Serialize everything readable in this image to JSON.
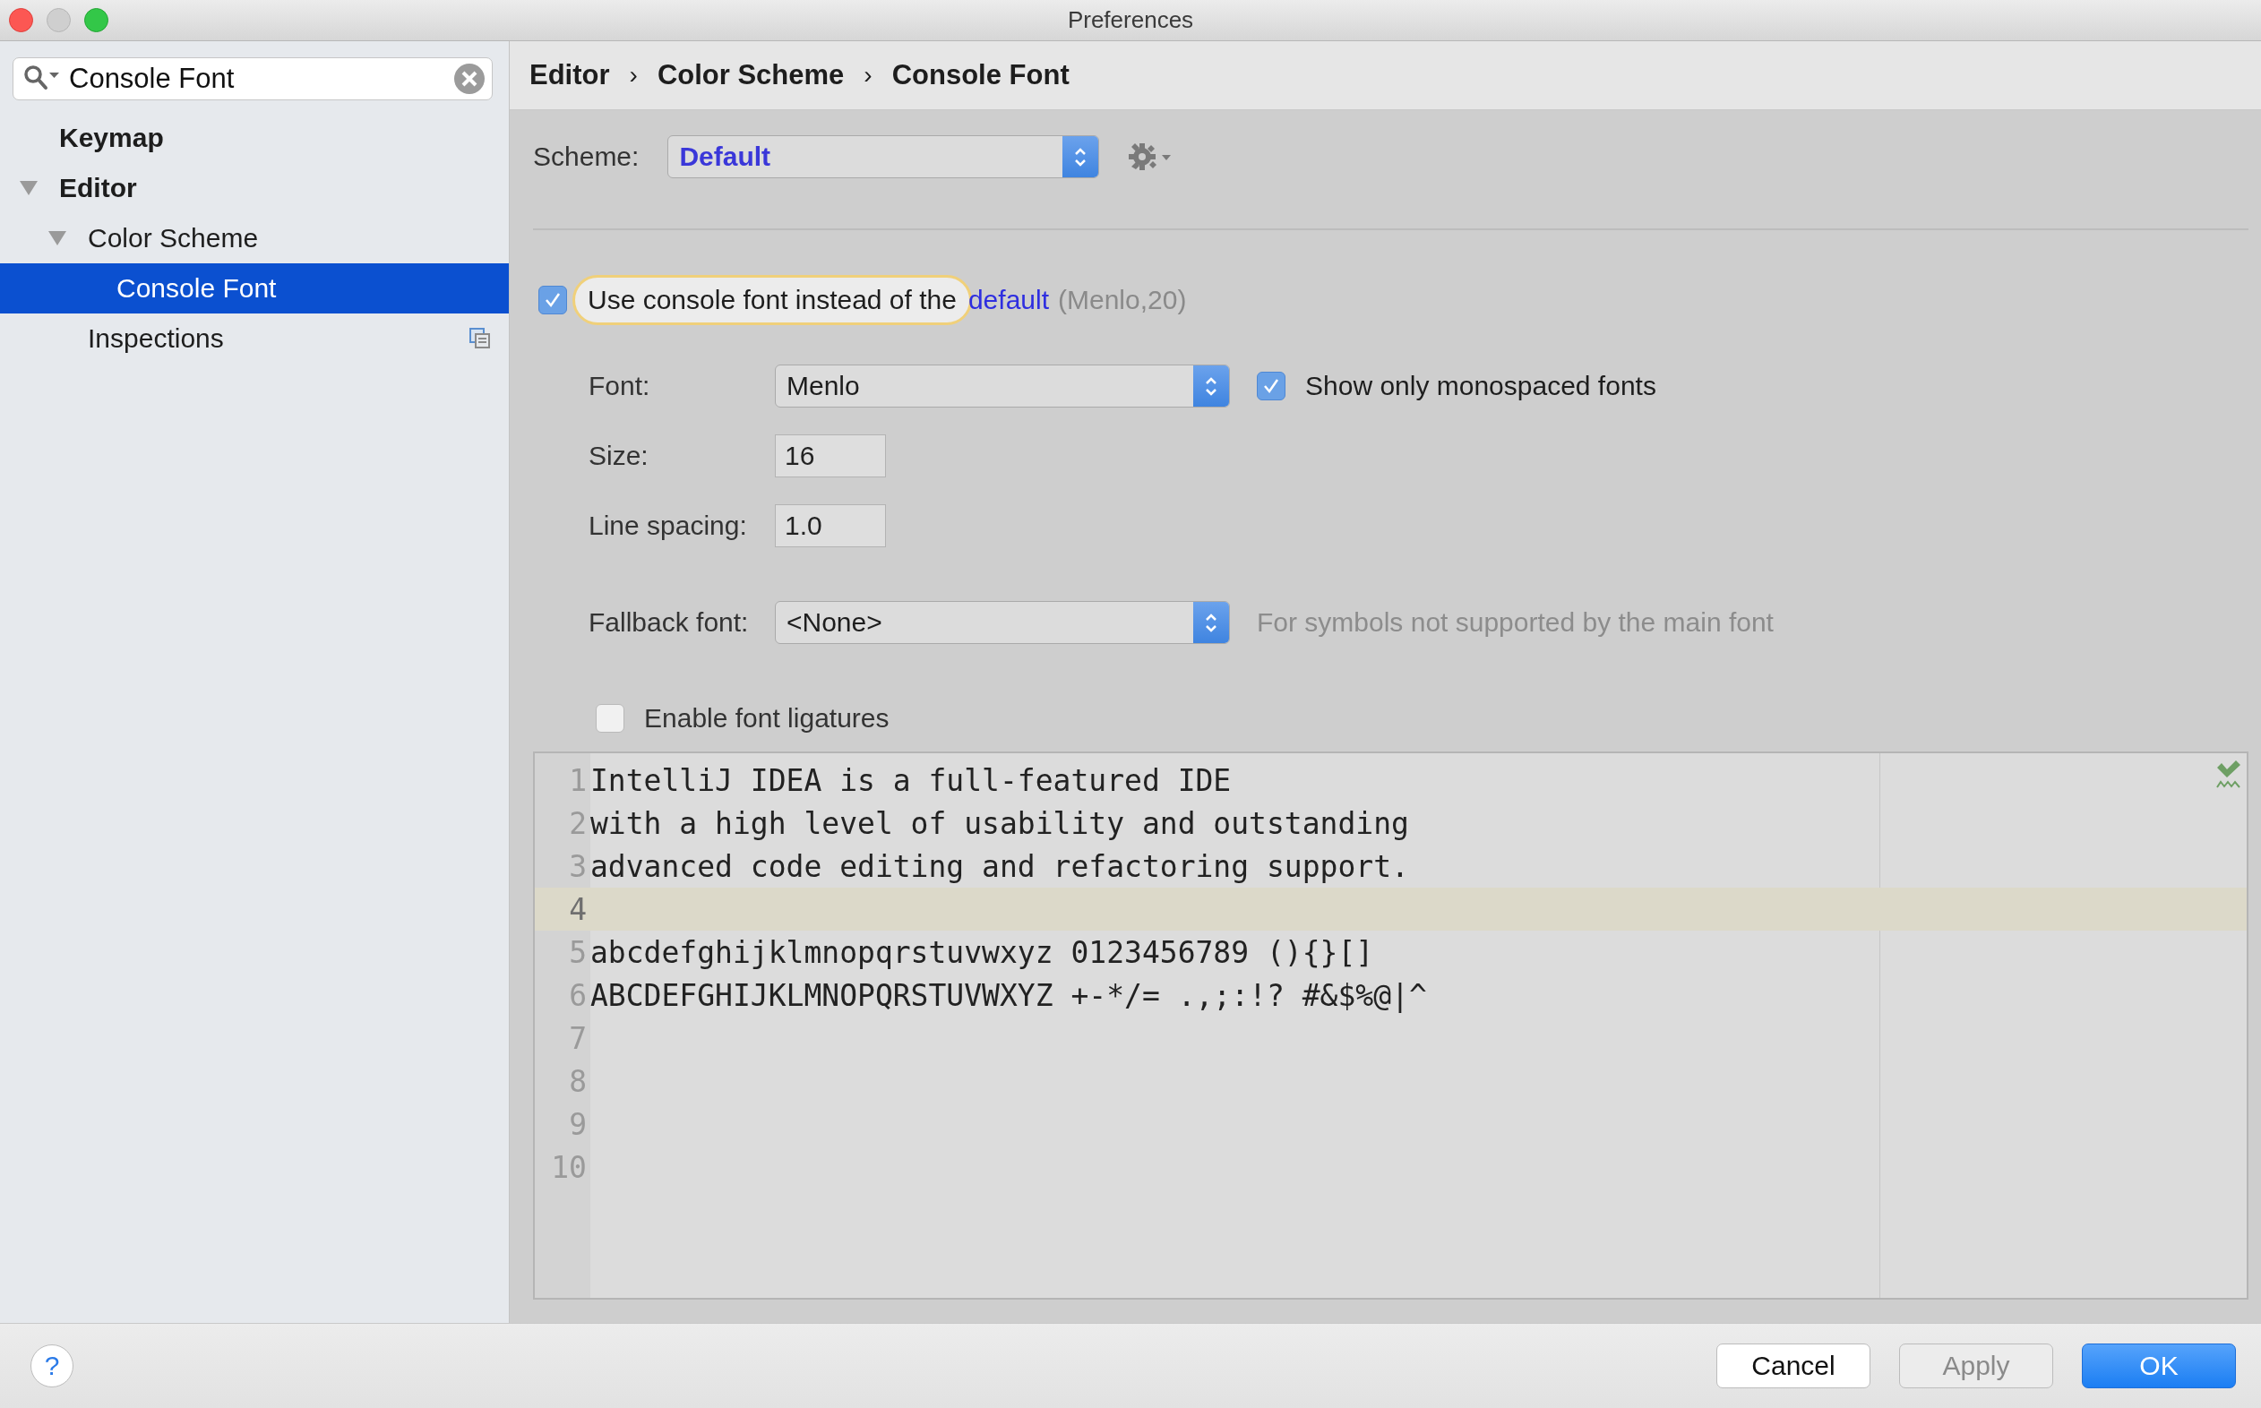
{
  "window": {
    "title": "Preferences"
  },
  "sidebar": {
    "search": {
      "value": "Console Font"
    },
    "tree": [
      {
        "label": "Keymap",
        "selected": false,
        "project_scoped": false
      },
      {
        "label": "Editor",
        "selected": false,
        "project_scoped": false,
        "expanded": true,
        "children": [
          {
            "label": "Color Scheme",
            "selected": false,
            "project_scoped": false,
            "expanded": true,
            "children": [
              {
                "label": "Console Font",
                "selected": true,
                "project_scoped": false
              }
            ]
          },
          {
            "label": "Inspections",
            "selected": false,
            "project_scoped": true
          }
        ]
      }
    ]
  },
  "breadcrumb": {
    "items": [
      "Editor",
      "Color Scheme",
      "Console Font"
    ],
    "separators": [
      "›",
      "›"
    ]
  },
  "scheme": {
    "label": "Scheme:",
    "value": "Default"
  },
  "use_console_font": {
    "checked": true,
    "focused": true,
    "label": "Use console font instead of the",
    "link": "default",
    "hint": "(Menlo,20)"
  },
  "font": {
    "label": "Font:",
    "value": "Menlo"
  },
  "monospaced": {
    "checked": true,
    "label": "Show only monospaced fonts"
  },
  "size": {
    "label": "Size:",
    "value": "16"
  },
  "line_spacing": {
    "label": "Line spacing:",
    "value": "1.0"
  },
  "fallback": {
    "label": "Fallback font:",
    "value": "<None>",
    "hint": "For symbols not supported by the main font"
  },
  "ligatures": {
    "checked": false,
    "label": "Enable font ligatures"
  },
  "preview": {
    "lines": [
      {
        "number": "1",
        "text": "IntelliJ IDEA is a full-featured IDE",
        "current": false
      },
      {
        "number": "2",
        "text": "with a high level of usability and outstanding",
        "current": false
      },
      {
        "number": "3",
        "text": "advanced code editing and refactoring support.",
        "current": false
      },
      {
        "number": "4",
        "current": true
      },
      {
        "number": "5",
        "text": "abcdefghijklmnopqrstuvwxyz 0123456789 (){}[]",
        "current": false
      },
      {
        "number": "6",
        "text": "ABCDEFGHIJKLMNOPQRSTUVWXYZ +-*/= .,;:!? #&$%@|^",
        "current": false
      },
      {
        "number": "7",
        "current": false
      },
      {
        "number": "8",
        "current": false
      },
      {
        "number": "9",
        "current": false
      },
      {
        "number": "10",
        "current": false
      }
    ]
  },
  "footer": {
    "help": "?",
    "buttons": [
      {
        "label": "Cancel",
        "kind": "normal"
      },
      {
        "label": "Apply",
        "kind": "disabled"
      },
      {
        "label": "OK",
        "kind": "primary"
      }
    ]
  }
}
